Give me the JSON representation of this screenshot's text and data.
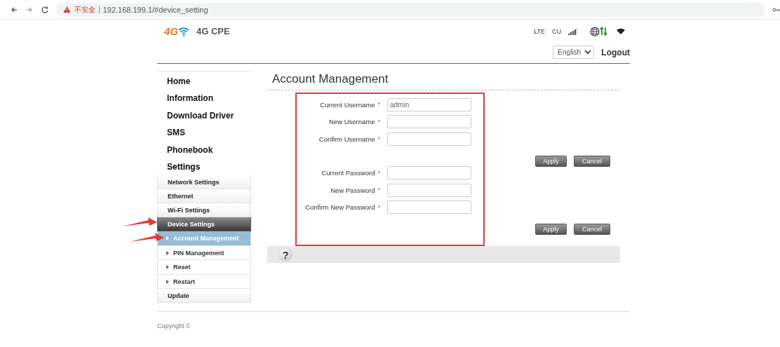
{
  "browser": {
    "security_label": "不安全",
    "url": "192.168.199.1/#device_setting"
  },
  "header": {
    "logo_text": "4G",
    "product": "4G CPE",
    "network_type": "LTE",
    "carrier": "CU",
    "language": "English",
    "logout": "Logout"
  },
  "nav": {
    "main_items": [
      {
        "label": "Home",
        "selected": false
      },
      {
        "label": "Information",
        "selected": false
      },
      {
        "label": "Download Driver",
        "selected": false
      },
      {
        "label": "SMS",
        "selected": false
      },
      {
        "label": "Phonebook",
        "selected": false
      },
      {
        "label": "Settings",
        "selected": true
      }
    ],
    "settings_items": [
      {
        "label": "Network Settings",
        "selected": false,
        "marked": false
      },
      {
        "label": "Ethernet",
        "selected": false,
        "marked": false
      },
      {
        "label": "Wi-Fi Settings",
        "selected": false,
        "marked": false
      },
      {
        "label": "Device Settings",
        "selected": true,
        "marked": true,
        "children": [
          {
            "label": "Account Management",
            "selected": true,
            "marked": true
          },
          {
            "label": "PIN Management",
            "selected": false,
            "marked": false
          },
          {
            "label": "Reset",
            "selected": false,
            "marked": false
          },
          {
            "label": "Restart",
            "selected": false,
            "marked": false
          }
        ]
      },
      {
        "label": "Update",
        "selected": false,
        "marked": false
      }
    ]
  },
  "page_title": "Account Management",
  "form": {
    "highlighted": true,
    "sections": [
      {
        "fields": [
          {
            "label": "Current Username",
            "required_mark": "*",
            "value": "admin"
          },
          {
            "label": "New Username",
            "required_mark": "*"
          },
          {
            "label": "Confirm Username",
            "required_mark": "*"
          }
        ],
        "buttons": [
          "Apply",
          "Cancel"
        ]
      },
      {
        "fields": [
          {
            "label": "Current Password",
            "required_mark": "*"
          },
          {
            "label": "New Password",
            "required_mark": "*"
          },
          {
            "label": "Confirm New Password",
            "required_mark": "*"
          }
        ],
        "buttons": [
          "Apply",
          "Cancel"
        ]
      }
    ]
  },
  "help": {
    "symbol": "?"
  },
  "copyright": "Copyright ©"
}
